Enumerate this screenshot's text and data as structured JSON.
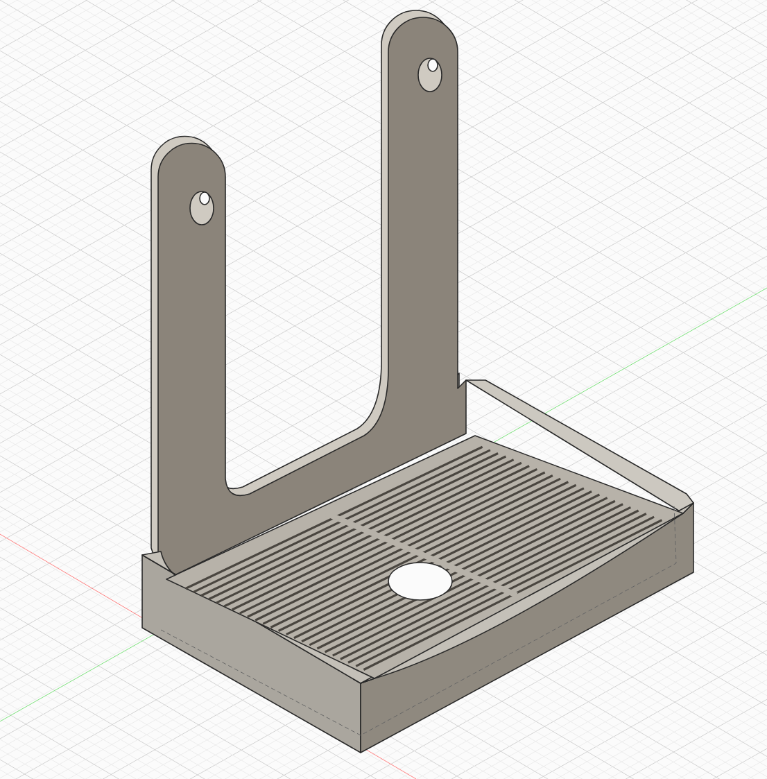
{
  "viewport": {
    "axes": [
      {
        "kind": "x",
        "color": "#ff8080"
      },
      {
        "kind": "y",
        "color": "#7ee27e"
      }
    ]
  }
}
